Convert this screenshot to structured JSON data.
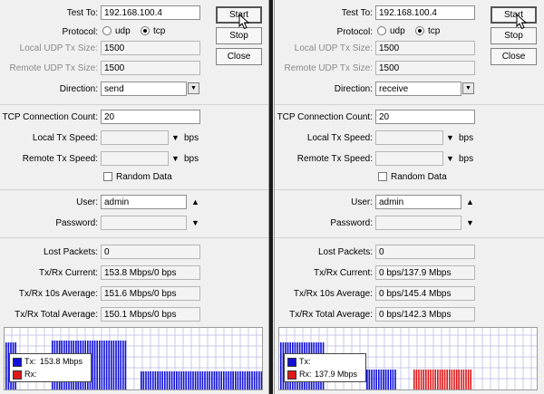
{
  "labels": {
    "test_to": "Test To:",
    "protocol": "Protocol:",
    "udp": "udp",
    "tcp": "tcp",
    "local_udp": "Local UDP Tx Size:",
    "remote_udp": "Remote UDP Tx Size:",
    "direction": "Direction:",
    "conn_count": "TCP Connection Count:",
    "local_tx": "Local Tx Speed:",
    "remote_tx": "Remote Tx Speed:",
    "bps": "bps",
    "random_data": "Random Data",
    "user": "User:",
    "password": "Password:",
    "lost_packets": "Lost Packets:",
    "current": "Tx/Rx Current:",
    "avg10": "Tx/Rx 10s Average:",
    "total_avg": "Tx/Rx Total Average:",
    "legend_tx": "Tx:",
    "legend_rx": "Rx:"
  },
  "buttons": {
    "start": "Start",
    "stop": "Stop",
    "close": "Close"
  },
  "colors": {
    "tx": "#1010d8",
    "rx": "#e01818",
    "grid": "#c9c9e8"
  },
  "icons": {
    "dropdown": "dropdown-arrow-icon",
    "up": "triangle-up-icon",
    "down": "triangle-down-icon",
    "cursor": "mouse-pointer-icon"
  },
  "left": {
    "test_to": "192.168.100.4",
    "protocol_selected": "tcp",
    "local_udp_size": "1500",
    "remote_udp_size": "1500",
    "direction": "send",
    "conn_count": "20",
    "local_tx_speed": "",
    "remote_tx_speed": "",
    "random_data": false,
    "user": "admin",
    "password": "",
    "lost_packets": "0",
    "current": "153.8 Mbps/0 bps",
    "avg10": "151.6 Mbps/0 bps",
    "total_avg": "150.1 Mbps/0 bps",
    "legend_tx_value": "153.8 Mbps",
    "legend_rx_value": ""
  },
  "right": {
    "test_to": "192.168.100.4",
    "protocol_selected": "tcp",
    "local_udp_size": "1500",
    "remote_udp_size": "1500",
    "direction": "receive",
    "conn_count": "20",
    "local_tx_speed": "",
    "remote_tx_speed": "",
    "random_data": false,
    "user": "admin",
    "password": "",
    "lost_packets": "0",
    "current": "0 bps/137.9 Mbps",
    "avg10": "0 bps/145.4 Mbps",
    "total_avg": "0 bps/142.3 Mbps",
    "legend_tx_value": "",
    "legend_rx_value": "137.9 Mbps"
  }
}
